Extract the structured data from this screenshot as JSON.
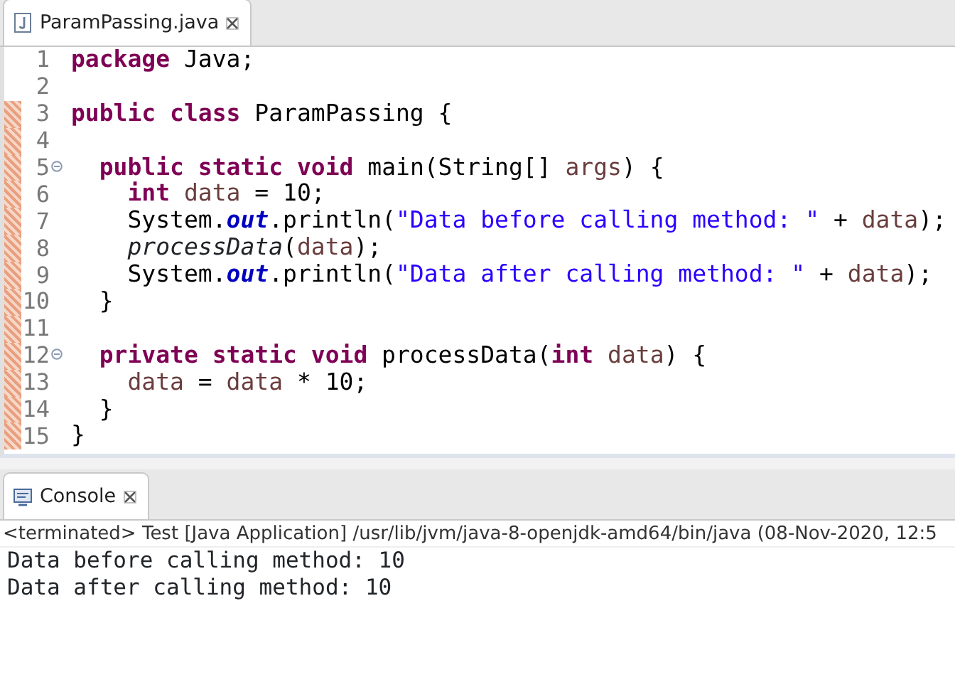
{
  "editor": {
    "tab": {
      "title": "ParamPassing.java",
      "selected": true
    },
    "lines": [
      {
        "number": "1",
        "fold_marker": false,
        "changed": false,
        "tokens": [
          {
            "text": "package",
            "kind": "keyword"
          },
          {
            "text": " Java;",
            "kind": "plain"
          }
        ]
      },
      {
        "number": "2",
        "fold_marker": false,
        "changed": false
      },
      {
        "number": "3",
        "fold_marker": false,
        "changed": true,
        "tokens": [
          {
            "text": "public",
            "kind": "keyword"
          },
          {
            "text": " class",
            "kind": "keyword"
          },
          {
            "text": " ParamPassing {",
            "kind": "plain"
          }
        ]
      },
      {
        "number": "4",
        "fold_marker": false,
        "changed": true
      },
      {
        "number": "5",
        "fold_marker": true,
        "changed": true,
        "tokens": [
          {
            "text": "  public",
            "kind": "keyword"
          },
          {
            "text": " static",
            "kind": "keyword"
          },
          {
            "text": " void",
            "kind": "keyword"
          },
          {
            "text": " main(String[] ",
            "kind": "plain"
          },
          {
            "text": "args",
            "kind": "variable"
          },
          {
            "text": ") {",
            "kind": "plain"
          }
        ]
      },
      {
        "number": "6",
        "fold_marker": false,
        "changed": true,
        "tokens": [
          {
            "text": "    int",
            "kind": "keyword"
          },
          {
            "text": " data",
            "kind": "variable"
          },
          {
            "text": " = 10;",
            "kind": "plain"
          }
        ]
      },
      {
        "number": "7",
        "fold_marker": false,
        "changed": true,
        "tokens": [
          {
            "text": "    System.",
            "kind": "plain"
          },
          {
            "text": "out",
            "kind": "field"
          },
          {
            "text": ".println(",
            "kind": "plain"
          },
          {
            "text": "\"Data before calling method: \"",
            "kind": "string"
          },
          {
            "text": " + ",
            "kind": "plain"
          },
          {
            "text": "data",
            "kind": "variable"
          },
          {
            "text": ");",
            "kind": "plain"
          }
        ]
      },
      {
        "number": "8",
        "fold_marker": false,
        "changed": true,
        "tokens": [
          {
            "text": "    processData",
            "kind": "call"
          },
          {
            "text": "(",
            "kind": "plain"
          },
          {
            "text": "data",
            "kind": "variable"
          },
          {
            "text": ");",
            "kind": "plain"
          }
        ]
      },
      {
        "number": "9",
        "fold_marker": false,
        "changed": true,
        "tokens": [
          {
            "text": "    System.",
            "kind": "plain"
          },
          {
            "text": "out",
            "kind": "field"
          },
          {
            "text": ".println(",
            "kind": "plain"
          },
          {
            "text": "\"Data after calling method: \"",
            "kind": "string"
          },
          {
            "text": " + ",
            "kind": "plain"
          },
          {
            "text": "data",
            "kind": "variable"
          },
          {
            "text": ");",
            "kind": "plain"
          }
        ]
      },
      {
        "number": "10",
        "fold_marker": false,
        "changed": true,
        "tokens": [
          {
            "text": "  }",
            "kind": "plain"
          }
        ]
      },
      {
        "number": "11",
        "fold_marker": false,
        "changed": true
      },
      {
        "number": "12",
        "fold_marker": true,
        "changed": true,
        "tokens": [
          {
            "text": "  private",
            "kind": "keyword"
          },
          {
            "text": " static",
            "kind": "keyword"
          },
          {
            "text": " void",
            "kind": "keyword"
          },
          {
            "text": " processData(",
            "kind": "plain"
          },
          {
            "text": "int",
            "kind": "keyword"
          },
          {
            "text": " data",
            "kind": "variable"
          },
          {
            "text": ") {",
            "kind": "plain"
          }
        ]
      },
      {
        "number": "13",
        "fold_marker": false,
        "changed": true,
        "tokens": [
          {
            "text": "    data",
            "kind": "variable"
          },
          {
            "text": " = ",
            "kind": "plain"
          },
          {
            "text": "data",
            "kind": "variable"
          },
          {
            "text": " * 10;",
            "kind": "plain"
          }
        ]
      },
      {
        "number": "14",
        "fold_marker": false,
        "changed": true,
        "tokens": [
          {
            "text": "  }",
            "kind": "plain"
          }
        ]
      },
      {
        "number": "15",
        "fold_marker": false,
        "changed": true,
        "tokens": [
          {
            "text": "}",
            "kind": "plain"
          }
        ]
      }
    ]
  },
  "console": {
    "tab": {
      "title": "Console",
      "selected": true
    },
    "status": "<terminated> Test [Java Application] /usr/lib/jvm/java-8-openjdk-amd64/bin/java  (08-Nov-2020, 12:5",
    "output": [
      "Data before calling method: 10",
      "Data after calling method: 10"
    ]
  }
}
